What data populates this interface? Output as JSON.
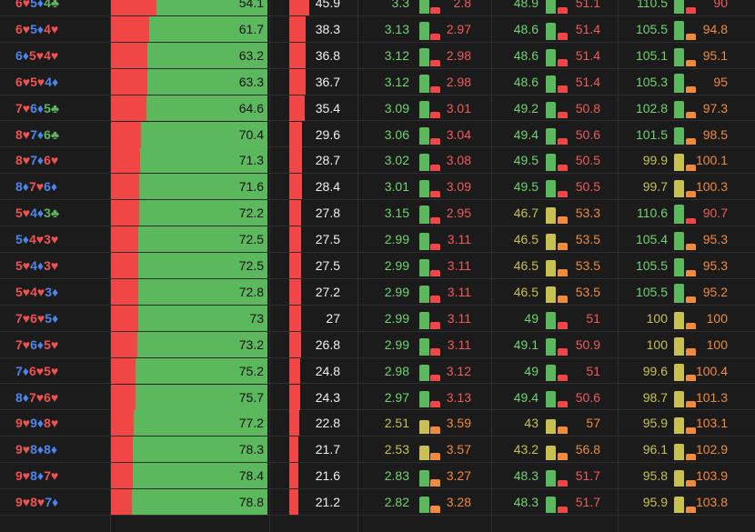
{
  "colors": {
    "background": "#1b1b1b",
    "heart": "#f25151",
    "diamond": "#4a86f0",
    "club": "#5cb85c",
    "bar_green": "#5cb85c",
    "bar_red": "#f04646",
    "bar_yellow": "#c8c050",
    "bar_orange": "#f08a3c",
    "text_green": "#6fd46f",
    "text_red": "#f05a5a",
    "text_yellow": "#c8c050",
    "text_orange": "#f08a3c"
  },
  "rows": [
    {
      "hand": [
        [
          "6",
          "♥"
        ],
        [
          "5",
          "♦"
        ],
        [
          "4",
          "♣"
        ]
      ],
      "win": "54.1",
      "lose": "45.9",
      "a": "3.3",
      "b": "2.8",
      "c": "48.9",
      "d": "51.1",
      "e": "110.5",
      "f": "90",
      "ab": [
        0.54,
        0.46
      ],
      "cd": [
        0.49,
        0.51
      ],
      "ef": [
        0.55,
        0.45
      ],
      "col": [
        "g",
        "r",
        "g",
        "r",
        "g",
        "r"
      ]
    },
    {
      "hand": [
        [
          "6",
          "♥"
        ],
        [
          "5",
          "♦"
        ],
        [
          "4",
          "♥"
        ]
      ],
      "win": "61.7",
      "lose": "38.3",
      "a": "3.13",
      "b": "2.97",
      "c": "48.6",
      "d": "51.4",
      "e": "105.5",
      "f": "94.8",
      "ab": [
        0.51,
        0.49
      ],
      "cd": [
        0.49,
        0.51
      ],
      "ef": [
        0.53,
        0.47
      ],
      "col": [
        "g",
        "r",
        "g",
        "r",
        "g",
        "o"
      ]
    },
    {
      "hand": [
        [
          "6",
          "♦"
        ],
        [
          "5",
          "♥"
        ],
        [
          "4",
          "♥"
        ]
      ],
      "win": "63.2",
      "lose": "36.8",
      "a": "3.12",
      "b": "2.98",
      "c": "48.6",
      "d": "51.4",
      "e": "105.1",
      "f": "95.1",
      "ab": [
        0.51,
        0.49
      ],
      "cd": [
        0.49,
        0.51
      ],
      "ef": [
        0.52,
        0.48
      ],
      "col": [
        "g",
        "r",
        "g",
        "r",
        "g",
        "o"
      ]
    },
    {
      "hand": [
        [
          "6",
          "♥"
        ],
        [
          "5",
          "♥"
        ],
        [
          "4",
          "♦"
        ]
      ],
      "win": "63.3",
      "lose": "36.7",
      "a": "3.12",
      "b": "2.98",
      "c": "48.6",
      "d": "51.4",
      "e": "105.3",
      "f": "95",
      "ab": [
        0.51,
        0.49
      ],
      "cd": [
        0.49,
        0.51
      ],
      "ef": [
        0.53,
        0.47
      ],
      "col": [
        "g",
        "r",
        "g",
        "r",
        "g",
        "o"
      ]
    },
    {
      "hand": [
        [
          "7",
          "♥"
        ],
        [
          "6",
          "♦"
        ],
        [
          "5",
          "♣"
        ]
      ],
      "win": "64.6",
      "lose": "35.4",
      "a": "3.09",
      "b": "3.01",
      "c": "49.2",
      "d": "50.8",
      "e": "102.8",
      "f": "97.3",
      "ab": [
        0.51,
        0.49
      ],
      "cd": [
        0.49,
        0.51
      ],
      "ef": [
        0.51,
        0.49
      ],
      "col": [
        "g",
        "r",
        "g",
        "r",
        "g",
        "o"
      ]
    },
    {
      "hand": [
        [
          "8",
          "♥"
        ],
        [
          "7",
          "♦"
        ],
        [
          "6",
          "♣"
        ]
      ],
      "win": "70.4",
      "lose": "29.6",
      "a": "3.06",
      "b": "3.04",
      "c": "49.4",
      "d": "50.6",
      "e": "101.5",
      "f": "98.5",
      "ab": [
        0.5,
        0.5
      ],
      "cd": [
        0.49,
        0.51
      ],
      "ef": [
        0.51,
        0.49
      ],
      "col": [
        "g",
        "r",
        "g",
        "r",
        "g",
        "o"
      ]
    },
    {
      "hand": [
        [
          "8",
          "♥"
        ],
        [
          "7",
          "♦"
        ],
        [
          "6",
          "♥"
        ]
      ],
      "win": "71.3",
      "lose": "28.7",
      "a": "3.02",
      "b": "3.08",
      "c": "49.5",
      "d": "50.5",
      "e": "99.9",
      "f": "100.1",
      "ab": [
        0.5,
        0.5
      ],
      "cd": [
        0.5,
        0.5
      ],
      "ef": [
        0.5,
        0.5
      ],
      "col": [
        "g",
        "r",
        "g",
        "r",
        "y",
        "o"
      ]
    },
    {
      "hand": [
        [
          "8",
          "♦"
        ],
        [
          "7",
          "♥"
        ],
        [
          "6",
          "♦"
        ]
      ],
      "win": "71.6",
      "lose": "28.4",
      "a": "3.01",
      "b": "3.09",
      "c": "49.5",
      "d": "50.5",
      "e": "99.7",
      "f": "100.3",
      "ab": [
        0.5,
        0.5
      ],
      "cd": [
        0.5,
        0.5
      ],
      "ef": [
        0.5,
        0.5
      ],
      "col": [
        "g",
        "r",
        "g",
        "r",
        "y",
        "o"
      ]
    },
    {
      "hand": [
        [
          "5",
          "♥"
        ],
        [
          "4",
          "♦"
        ],
        [
          "3",
          "♣"
        ]
      ],
      "win": "72.2",
      "lose": "27.8",
      "a": "3.15",
      "b": "2.95",
      "c": "46.7",
      "d": "53.3",
      "e": "110.6",
      "f": "90.7",
      "ab": [
        0.52,
        0.48
      ],
      "cd": [
        0.47,
        0.53
      ],
      "ef": [
        0.55,
        0.45
      ],
      "col": [
        "g",
        "r",
        "y",
        "o",
        "g",
        "r"
      ]
    },
    {
      "hand": [
        [
          "5",
          "♦"
        ],
        [
          "4",
          "♥"
        ],
        [
          "3",
          "♥"
        ]
      ],
      "win": "72.5",
      "lose": "27.5",
      "a": "2.99",
      "b": "3.11",
      "c": "46.5",
      "d": "53.5",
      "e": "105.4",
      "f": "95.3",
      "ab": [
        0.49,
        0.51
      ],
      "cd": [
        0.47,
        0.53
      ],
      "ef": [
        0.53,
        0.47
      ],
      "col": [
        "g",
        "r",
        "y",
        "o",
        "g",
        "o"
      ]
    },
    {
      "hand": [
        [
          "5",
          "♥"
        ],
        [
          "4",
          "♦"
        ],
        [
          "3",
          "♥"
        ]
      ],
      "win": "72.5",
      "lose": "27.5",
      "a": "2.99",
      "b": "3.11",
      "c": "46.5",
      "d": "53.5",
      "e": "105.5",
      "f": "95.3",
      "ab": [
        0.49,
        0.51
      ],
      "cd": [
        0.47,
        0.53
      ],
      "ef": [
        0.53,
        0.47
      ],
      "col": [
        "g",
        "r",
        "y",
        "o",
        "g",
        "o"
      ]
    },
    {
      "hand": [
        [
          "5",
          "♥"
        ],
        [
          "4",
          "♥"
        ],
        [
          "3",
          "♦"
        ]
      ],
      "win": "72.8",
      "lose": "27.2",
      "a": "2.99",
      "b": "3.11",
      "c": "46.5",
      "d": "53.5",
      "e": "105.5",
      "f": "95.2",
      "ab": [
        0.49,
        0.51
      ],
      "cd": [
        0.47,
        0.53
      ],
      "ef": [
        0.53,
        0.47
      ],
      "col": [
        "g",
        "r",
        "y",
        "o",
        "g",
        "o"
      ]
    },
    {
      "hand": [
        [
          "7",
          "♥"
        ],
        [
          "6",
          "♥"
        ],
        [
          "5",
          "♦"
        ]
      ],
      "win": "73",
      "lose": "27",
      "a": "2.99",
      "b": "3.11",
      "c": "49",
      "d": "51",
      "e": "100",
      "f": "100",
      "ab": [
        0.49,
        0.51
      ],
      "cd": [
        0.49,
        0.51
      ],
      "ef": [
        0.5,
        0.5
      ],
      "col": [
        "g",
        "r",
        "g",
        "r",
        "y",
        "o"
      ]
    },
    {
      "hand": [
        [
          "7",
          "♥"
        ],
        [
          "6",
          "♦"
        ],
        [
          "5",
          "♥"
        ]
      ],
      "win": "73.2",
      "lose": "26.8",
      "a": "2.99",
      "b": "3.11",
      "c": "49.1",
      "d": "50.9",
      "e": "100",
      "f": "100",
      "ab": [
        0.49,
        0.51
      ],
      "cd": [
        0.49,
        0.51
      ],
      "ef": [
        0.5,
        0.5
      ],
      "col": [
        "g",
        "r",
        "g",
        "r",
        "y",
        "o"
      ]
    },
    {
      "hand": [
        [
          "7",
          "♦"
        ],
        [
          "6",
          "♥"
        ],
        [
          "5",
          "♥"
        ]
      ],
      "win": "75.2",
      "lose": "24.8",
      "a": "2.98",
      "b": "3.12",
      "c": "49",
      "d": "51",
      "e": "99.6",
      "f": "100.4",
      "ab": [
        0.49,
        0.51
      ],
      "cd": [
        0.49,
        0.51
      ],
      "ef": [
        0.5,
        0.5
      ],
      "col": [
        "g",
        "r",
        "g",
        "r",
        "y",
        "o"
      ]
    },
    {
      "hand": [
        [
          "8",
          "♦"
        ],
        [
          "7",
          "♥"
        ],
        [
          "6",
          "♥"
        ]
      ],
      "win": "75.7",
      "lose": "24.3",
      "a": "2.97",
      "b": "3.13",
      "c": "49.4",
      "d": "50.6",
      "e": "98.7",
      "f": "101.3",
      "ab": [
        0.49,
        0.51
      ],
      "cd": [
        0.49,
        0.51
      ],
      "ef": [
        0.49,
        0.51
      ],
      "col": [
        "g",
        "r",
        "g",
        "r",
        "y",
        "o"
      ]
    },
    {
      "hand": [
        [
          "9",
          "♥"
        ],
        [
          "9",
          "♦"
        ],
        [
          "8",
          "♥"
        ]
      ],
      "win": "77.2",
      "lose": "22.8",
      "a": "2.51",
      "b": "3.59",
      "c": "43",
      "d": "57",
      "e": "95.9",
      "f": "103.1",
      "ab": [
        0.41,
        0.59
      ],
      "cd": [
        0.43,
        0.57
      ],
      "ef": [
        0.48,
        0.52
      ],
      "col": [
        "y",
        "o",
        "y",
        "o",
        "y",
        "o"
      ]
    },
    {
      "hand": [
        [
          "9",
          "♥"
        ],
        [
          "8",
          "♦"
        ],
        [
          "8",
          "♦"
        ]
      ],
      "win": "78.3",
      "lose": "21.7",
      "a": "2.53",
      "b": "3.57",
      "c": "43.2",
      "d": "56.8",
      "e": "96.1",
      "f": "102.9",
      "ab": [
        0.41,
        0.59
      ],
      "cd": [
        0.43,
        0.57
      ],
      "ef": [
        0.48,
        0.52
      ],
      "col": [
        "y",
        "o",
        "y",
        "o",
        "y",
        "o"
      ]
    },
    {
      "hand": [
        [
          "9",
          "♥"
        ],
        [
          "8",
          "♦"
        ],
        [
          "7",
          "♥"
        ]
      ],
      "win": "78.4",
      "lose": "21.6",
      "a": "2.83",
      "b": "3.27",
      "c": "48.3",
      "d": "51.7",
      "e": "95.8",
      "f": "103.9",
      "ab": [
        0.46,
        0.54
      ],
      "cd": [
        0.48,
        0.52
      ],
      "ef": [
        0.48,
        0.52
      ],
      "col": [
        "g",
        "o",
        "g",
        "r",
        "y",
        "o"
      ]
    },
    {
      "hand": [
        [
          "9",
          "♥"
        ],
        [
          "8",
          "♥"
        ],
        [
          "7",
          "♦"
        ]
      ],
      "win": "78.8",
      "lose": "21.2",
      "a": "2.82",
      "b": "3.28",
      "c": "48.3",
      "d": "51.7",
      "e": "95.9",
      "f": "103.8",
      "ab": [
        0.46,
        0.54
      ],
      "cd": [
        0.48,
        0.52
      ],
      "ef": [
        0.48,
        0.52
      ],
      "col": [
        "g",
        "o",
        "g",
        "r",
        "y",
        "o"
      ]
    }
  ]
}
